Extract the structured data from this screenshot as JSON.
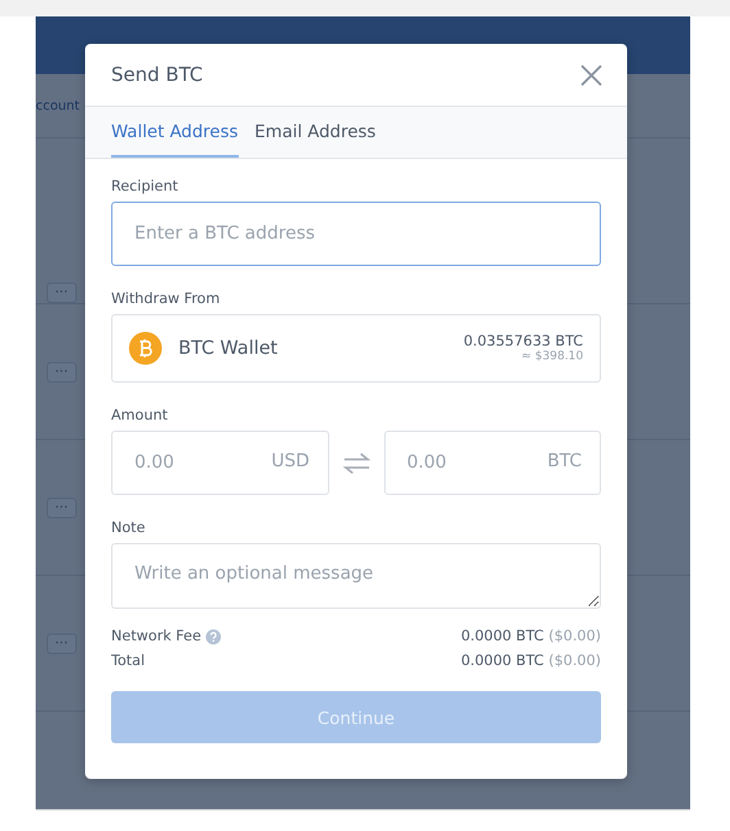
{
  "background": {
    "tab_label": "ccount",
    "row_menus": [
      "···",
      "···",
      "···",
      "···"
    ]
  },
  "dialog": {
    "title": "Send BTC",
    "tabs": [
      {
        "label": "Wallet Address",
        "selected": true
      },
      {
        "label": "Email Address",
        "selected": false
      }
    ],
    "recipient": {
      "label": "Recipient",
      "placeholder": "Enter a BTC address",
      "focused": true
    },
    "withdraw_from": {
      "label": "Withdraw From",
      "wallet": "BTC Wallet",
      "balance": "0.03557633 BTC",
      "balance_usd": "≈ $398.10"
    },
    "amount": {
      "label": "Amount",
      "fields": [
        {
          "placeholder": "0.00",
          "currency": "USD"
        },
        {
          "placeholder": "0.00",
          "currency": "BTC"
        }
      ]
    },
    "note": {
      "label": "Note",
      "placeholder": "Write an optional message"
    },
    "summary": [
      {
        "label": "Network Fee",
        "help": true,
        "btc": "0.0000 BTC",
        "usd": "($0.00)"
      },
      {
        "label": "Total",
        "help": false,
        "btc": "0.0000 BTC",
        "usd": "($0.00)"
      }
    ],
    "continue_button": {
      "label": "Continue",
      "disabled": true
    }
  }
}
